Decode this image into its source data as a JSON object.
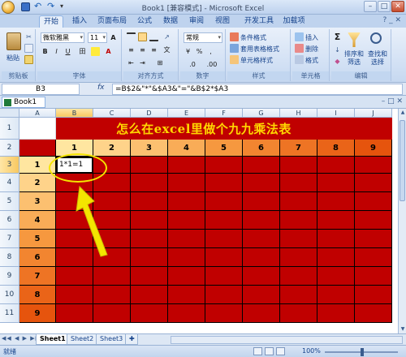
{
  "window": {
    "title": "Book1  [兼容模式]  -  Microsoft Excel",
    "min": "–",
    "max": "□",
    "close": "✕"
  },
  "tabs": [
    "开始",
    "插入",
    "页面布局",
    "公式",
    "数据",
    "审阅",
    "视图",
    "开发工具",
    "加载项"
  ],
  "ribbon": {
    "clipboard": {
      "paste": "粘贴",
      "label": "剪贴板"
    },
    "font": {
      "name": "微软雅黑",
      "size": "11",
      "label": "字体",
      "bold": "B",
      "italic": "I",
      "underline": "U",
      "grow": "A",
      "shrink": "A",
      "border": "田",
      "font_color_glyph": "A"
    },
    "alignment": {
      "label": "对齐方式",
      "wen": "文"
    },
    "number": {
      "format": "常规",
      "label": "数字",
      "percent": "%",
      "comma": ",",
      "currency": "¥",
      "dec_inc": ".0",
      "dec_dec": ".00"
    },
    "styles": {
      "conditional": "条件格式",
      "table": "套用表格格式",
      "cell": "单元格样式",
      "label": "样式"
    },
    "cells": {
      "insert": "插入",
      "delete": "删除",
      "format": "格式",
      "label": "单元格"
    },
    "editing": {
      "sigma": "Σ",
      "sort": "排序和筛选",
      "find": "查找和选择",
      "label": "编辑"
    }
  },
  "formula_bar": {
    "name_box": "B3",
    "fx": "fx",
    "formula": "=B$2&\"*\"&$A3&\"=\"&B$2*$A3"
  },
  "book_tab": "Book1",
  "columns": [
    "A",
    "B",
    "C",
    "D",
    "E",
    "F",
    "G",
    "H",
    "I",
    "J"
  ],
  "rows": [
    "1",
    "2",
    "3",
    "4",
    "5",
    "6",
    "7",
    "8",
    "9",
    "10",
    "11"
  ],
  "sheet_title": "怎么在excel里做个九九乘法表",
  "header_numbers": [
    "1",
    "2",
    "3",
    "4",
    "5",
    "6",
    "7",
    "8",
    "9"
  ],
  "row_numbers": [
    "1",
    "2",
    "3",
    "4",
    "5",
    "6",
    "7",
    "8",
    "9"
  ],
  "active_cell_value": "1*1=1",
  "sheet_tabs": [
    "Sheet1",
    "Sheet2",
    "Sheet3"
  ],
  "status": {
    "ready": "就绪",
    "zoom": "100%",
    "zoom_out": "⊖",
    "zoom_in": "⊕"
  },
  "colors": {
    "header_gradient": [
      "#ffe6a0",
      "#fed38a",
      "#fcc070",
      "#f9ac57",
      "#f6983f",
      "#f28530",
      "#ee7424",
      "#ea6418",
      "#e6540d"
    ],
    "red_fill": "#c00000",
    "title_text": "#ffd700",
    "highlight": "#f4e500"
  },
  "help": "? _ ✕"
}
